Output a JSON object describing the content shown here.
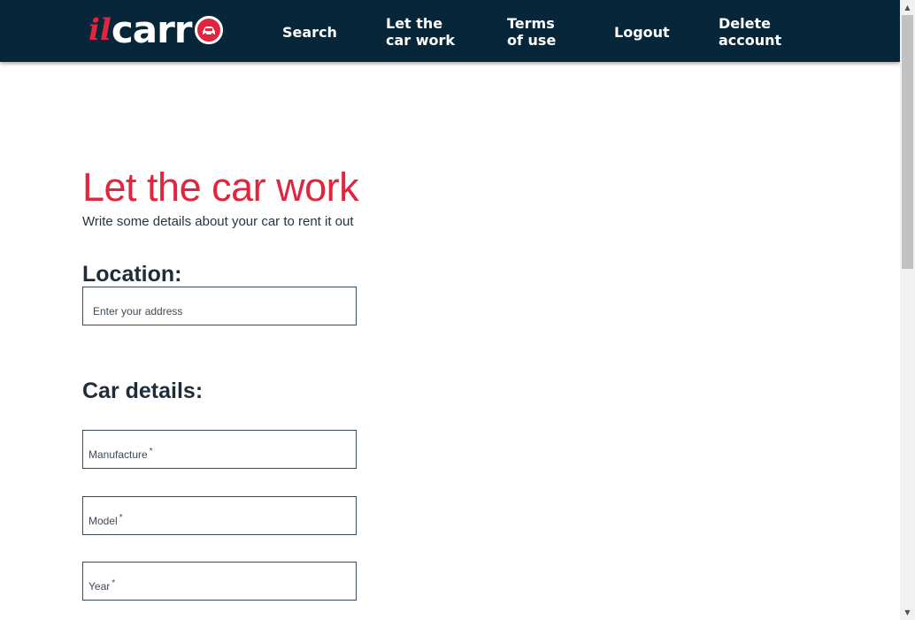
{
  "brand": {
    "il": "il",
    "carr": "carr"
  },
  "nav": [
    {
      "line1": "Search",
      "line2": ""
    },
    {
      "line1": "Let the",
      "line2": "car work"
    },
    {
      "line1": "Terms",
      "line2": "of use"
    },
    {
      "line1": "Logout",
      "line2": ""
    },
    {
      "line1": "Delete",
      "line2": "account"
    }
  ],
  "main": {
    "title": "Let the car work",
    "subtitle": "Write some details about your car to rent it out",
    "location_label": "Location:",
    "location_placeholder": "Enter your address",
    "car_details_label": "Car details:",
    "fields": [
      {
        "label": "Manufacture",
        "required_mark": "*"
      },
      {
        "label": "Model",
        "required_mark": "*"
      },
      {
        "label": "Year",
        "required_mark": "*"
      }
    ]
  },
  "colors": {
    "nav_bg": "#07263a",
    "accent": "#e0263f"
  },
  "icons": {
    "logo_badge": "car-icon",
    "scroll_up": "arrow-up-icon",
    "scroll_down": "arrow-down-icon"
  }
}
